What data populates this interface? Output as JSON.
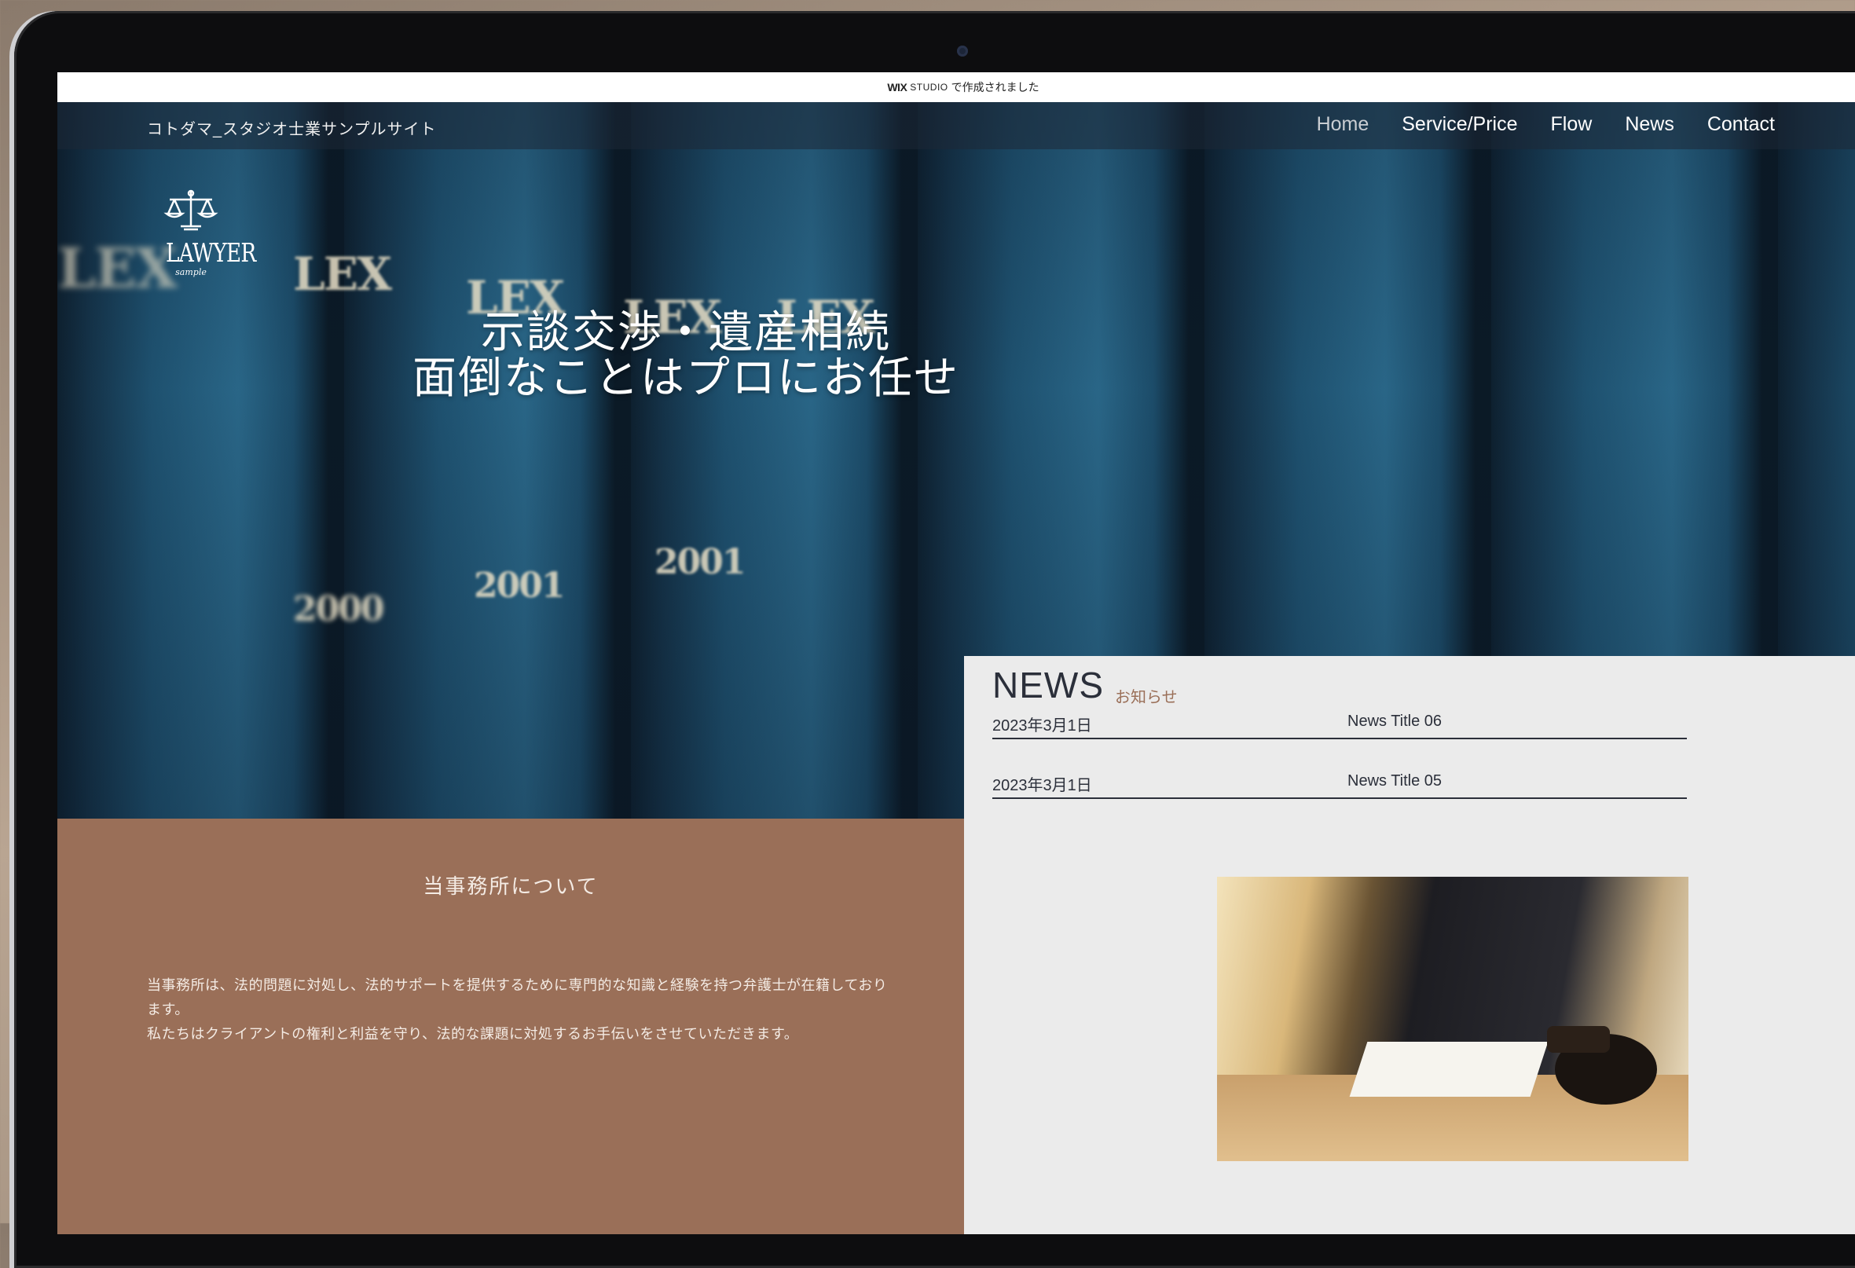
{
  "banner": {
    "wix": "WIX",
    "studio": "STUDIO",
    "text": "で作成されました"
  },
  "site": {
    "name": "コトダマ_スタジオ士業サンプルサイト"
  },
  "nav": {
    "items": [
      {
        "label": "Home",
        "active": true
      },
      {
        "label": "Service/Price",
        "active": false
      },
      {
        "label": "Flow",
        "active": false
      },
      {
        "label": "News",
        "active": false
      },
      {
        "label": "Contact",
        "active": false
      }
    ]
  },
  "logo": {
    "icon": "scales-of-justice-icon",
    "text": "LAWYER",
    "sub": "sample"
  },
  "hero": {
    "line1": "示談交渉・遺産相続",
    "line2": "面倒なことはプロにお任せ",
    "spines": [
      "LEX",
      "LEX",
      "LEX",
      "LEX",
      "LEX",
      "2001",
      "2001",
      "2000"
    ]
  },
  "about": {
    "heading": "当事務所について",
    "body1": "当事務所は、法的問題に対処し、法的サポートを提供するために専門的な知識と経験を持つ弁護士が在籍しております。",
    "body2": "私たちはクライアントの権利と利益を守り、法的な課題に対処するお手伝いをさせていただきます。"
  },
  "news": {
    "title": "NEWS",
    "subtitle": "お知らせ",
    "items": [
      {
        "date": "2023年3月1日",
        "title": "News Title 06"
      },
      {
        "date": "2023年3月1日",
        "title": "News Title 05"
      }
    ]
  },
  "colors": {
    "about_bg": "#9a6f58",
    "news_bg": "#ebebeb",
    "text_dark": "#2b2f3a"
  }
}
